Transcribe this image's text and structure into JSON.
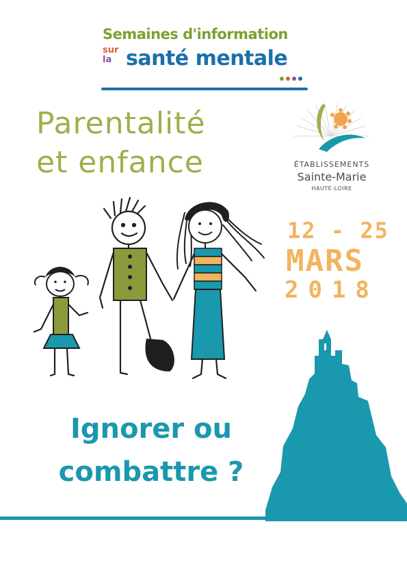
{
  "header": {
    "line1": "Semaines d'information",
    "sur": "sur",
    "la": "la",
    "line2": "santé mentale"
  },
  "theme": {
    "line1": "Parentalité",
    "line2": "et enfance"
  },
  "organisation": {
    "line1": "ÉTABLISSEMENTS",
    "line2": "Sainte-Marie",
    "line3": "HAUTE-LOIRE"
  },
  "dates": {
    "line1": "12 - 25",
    "line2": "MARS",
    "line3": "2018"
  },
  "question": {
    "line1": "Ignorer ou",
    "line2": "combattre ?"
  },
  "colors": {
    "teal": "#1a98ad",
    "green": "#a3ad4a",
    "orange": "#f2b45f",
    "blue": "#1b70a8",
    "olive": "#8c9a3b"
  }
}
